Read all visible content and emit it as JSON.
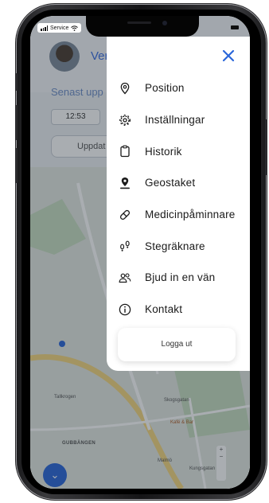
{
  "status_bar": {
    "carrier": "Service",
    "icons": [
      "signal-icon",
      "wifi-icon",
      "battery-icon"
    ]
  },
  "app": {
    "user_name": "Ver",
    "last_updated_label": "Senast upp",
    "time": "12:53",
    "update_button_label": "Uppdat"
  },
  "map": {
    "labels": [
      "Tallkrogen",
      "GUBBÄNGEN",
      "Skogsgatan",
      "Kafé & Bar",
      "Malmö",
      "Kungsgatan"
    ]
  },
  "menu": {
    "close_icon": "close-icon",
    "items": [
      {
        "label": "Position",
        "icon": "location-pin-icon"
      },
      {
        "label": "Inställningar",
        "icon": "gear-icon"
      },
      {
        "label": "Historik",
        "icon": "clipboard-icon"
      },
      {
        "label": "Geostaket",
        "icon": "geofence-icon"
      },
      {
        "label": "Medicinpåminnare",
        "icon": "pill-icon"
      },
      {
        "label": "Stegräknare",
        "icon": "footsteps-icon"
      },
      {
        "label": "Bjud in en vän",
        "icon": "invite-users-icon"
      },
      {
        "label": "Kontakt",
        "icon": "info-icon"
      }
    ],
    "logout_label": "Logga ut"
  },
  "colors": {
    "accent": "#2a66d9",
    "menu_bg": "#ffffff",
    "text": "#1a1a1a",
    "overlay": "#1e2832"
  }
}
